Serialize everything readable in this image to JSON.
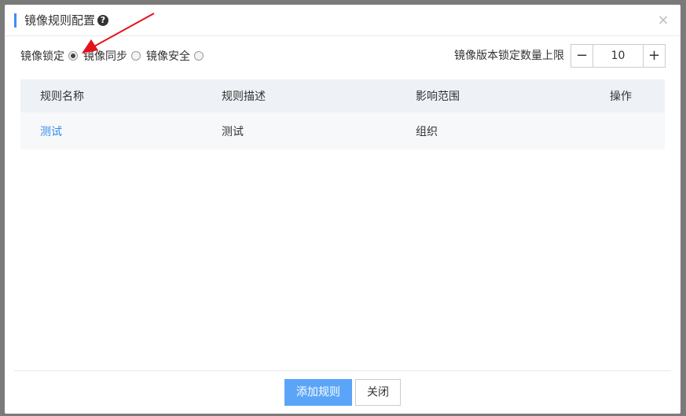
{
  "dialog": {
    "title": "镜像规则配置",
    "help_icon_glyph": "?",
    "close_glyph": "×"
  },
  "rule_types": {
    "options": [
      {
        "label": "镜像锁定",
        "checked": true
      },
      {
        "label": "镜像同步",
        "checked": false
      },
      {
        "label": "镜像安全",
        "checked": false
      }
    ]
  },
  "version_limit": {
    "label": "镜像版本锁定数量上限",
    "value": "10",
    "minus": "−",
    "plus": "+"
  },
  "table": {
    "headers": [
      "规则名称",
      "规则描述",
      "影响范围",
      "操作"
    ],
    "rows": [
      {
        "name": "测试",
        "description": "测试",
        "scope": "组织",
        "actions": ""
      }
    ]
  },
  "footer": {
    "add_label": "添加规则",
    "close_label": "关闭"
  },
  "colors": {
    "accent": "#3d8ef5",
    "primary_button": "#5aa5f8",
    "link": "#2e8ded",
    "annotation_arrow": "#e3121b"
  }
}
